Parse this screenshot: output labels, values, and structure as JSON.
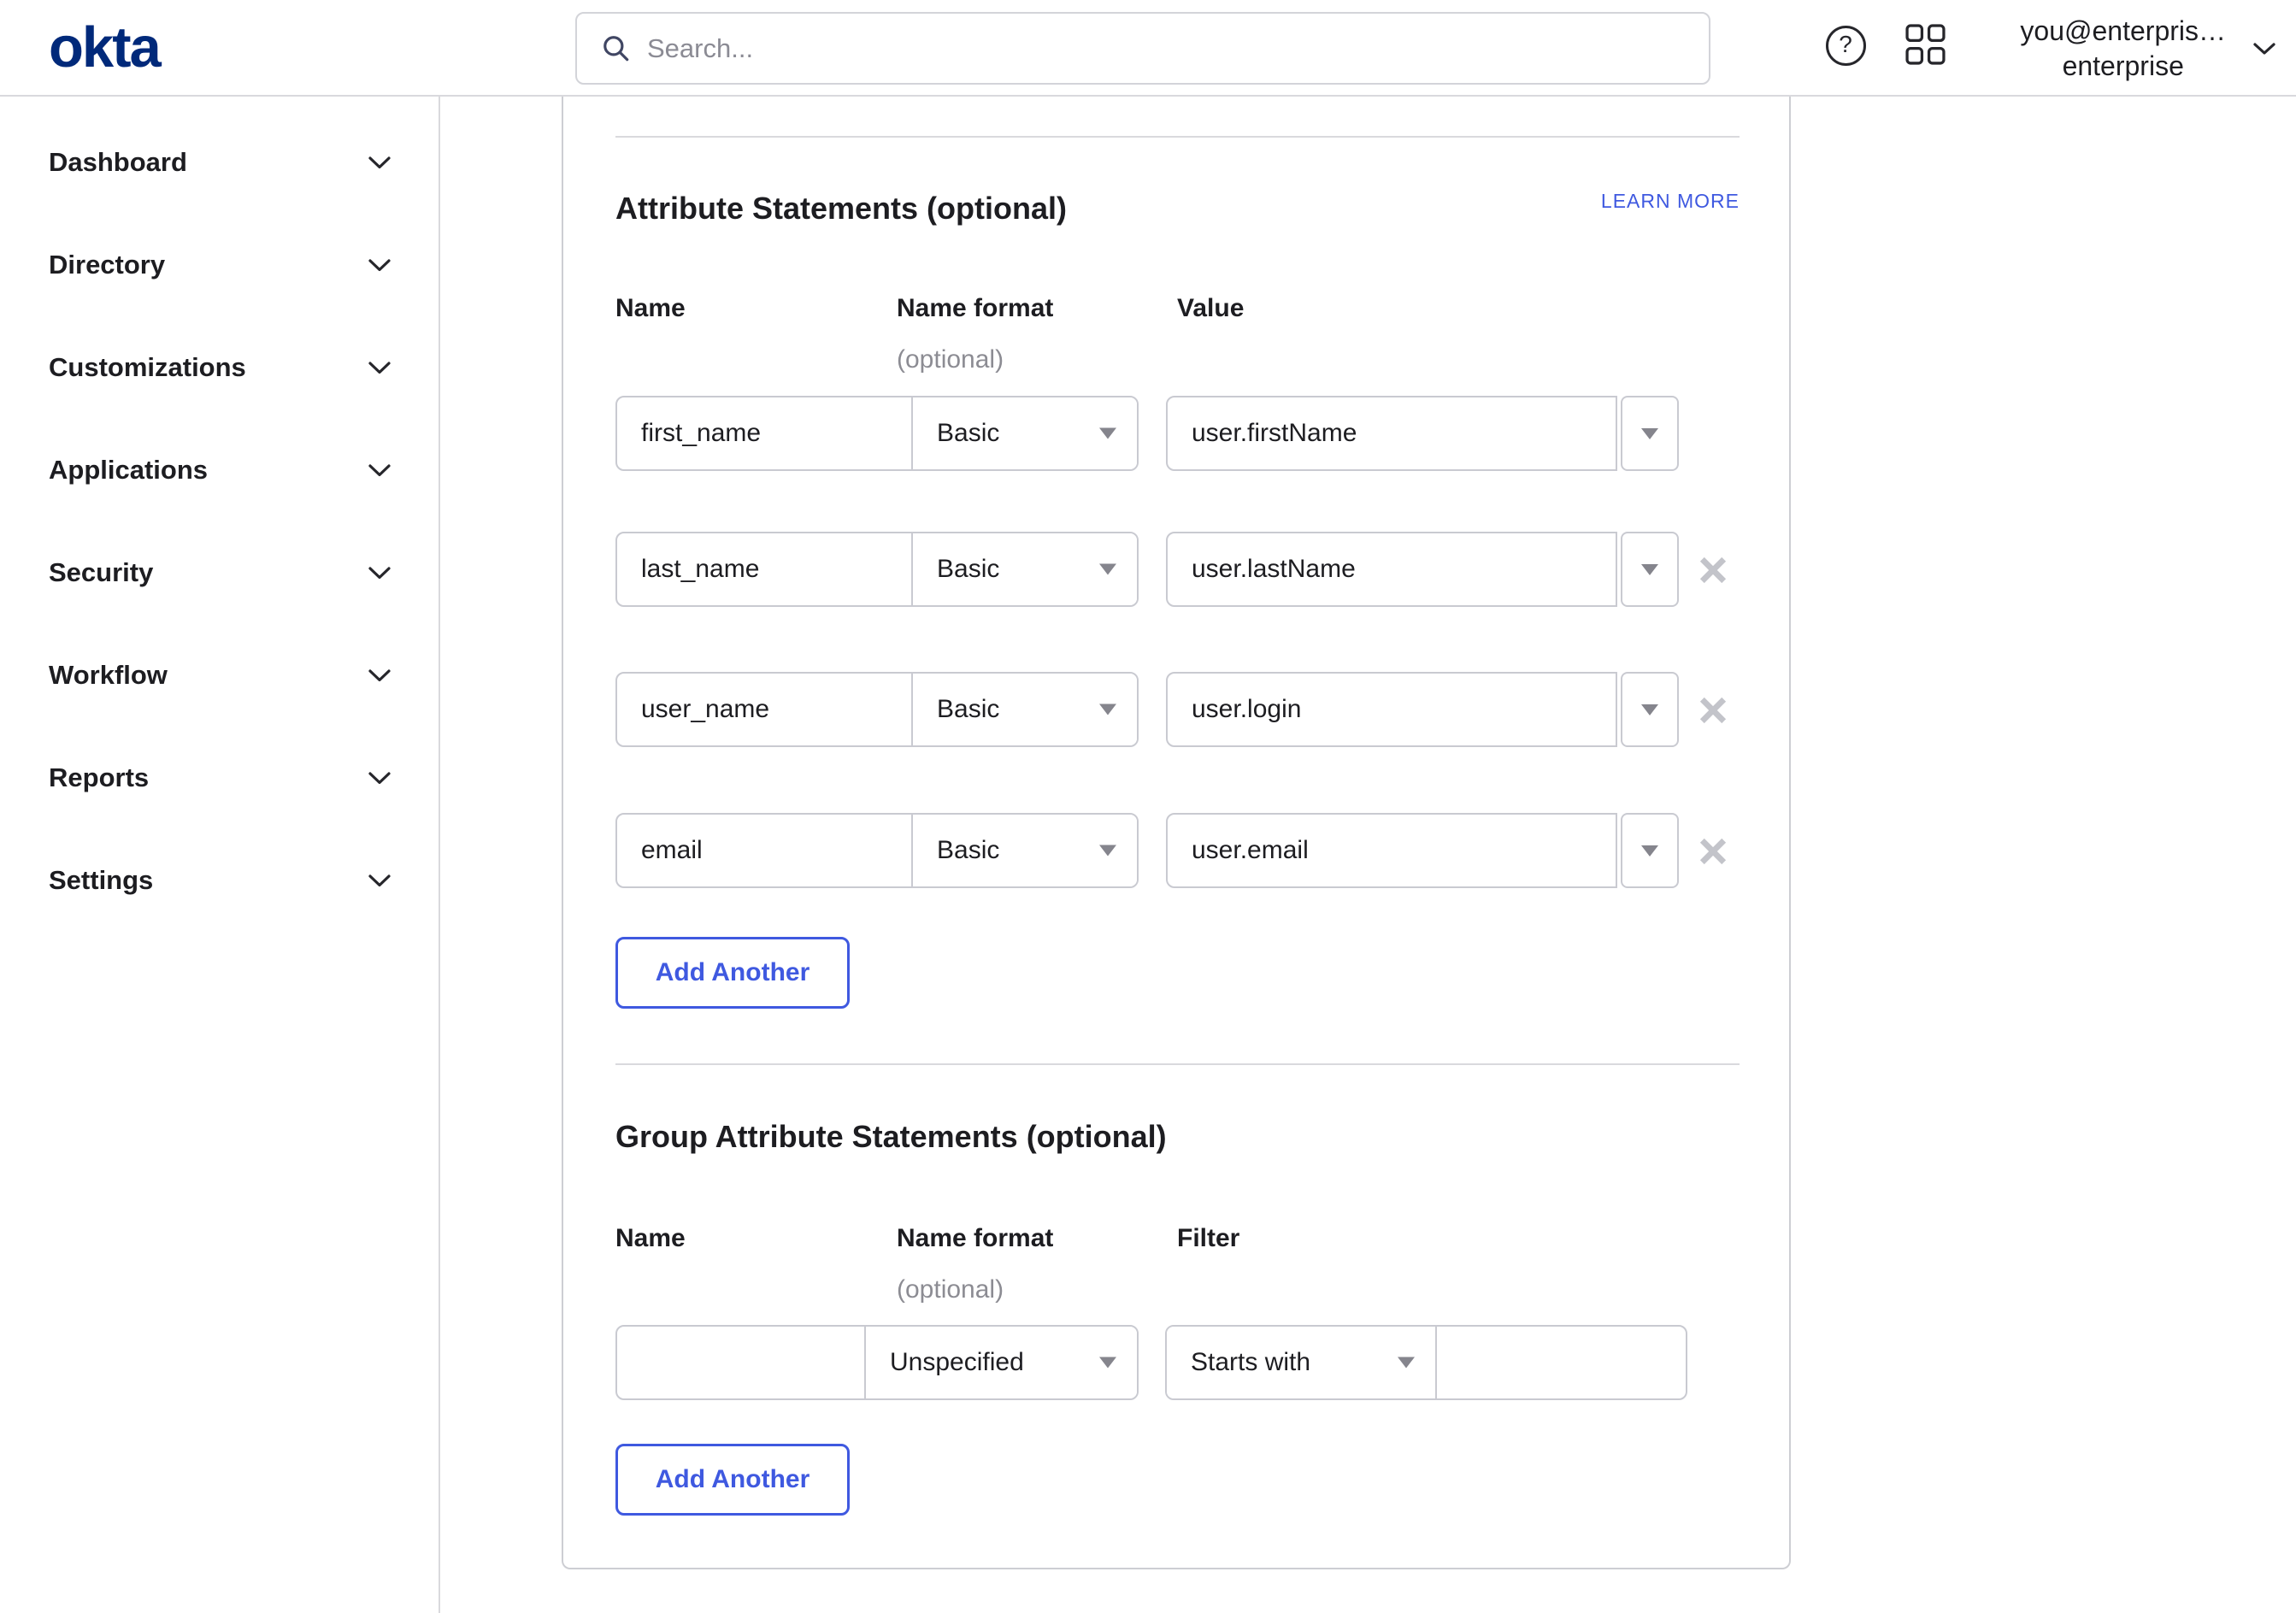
{
  "topbar": {
    "logo": "okta",
    "search_placeholder": "Search...",
    "account": {
      "line1": "you@enterpris…",
      "line2": "enterprise"
    }
  },
  "icons": {
    "help_glyph": "?"
  },
  "sidebar": {
    "items": [
      {
        "label": "Dashboard"
      },
      {
        "label": "Directory"
      },
      {
        "label": "Customizations"
      },
      {
        "label": "Applications"
      },
      {
        "label": "Security"
      },
      {
        "label": "Workflow"
      },
      {
        "label": "Reports"
      },
      {
        "label": "Settings"
      }
    ]
  },
  "main": {
    "attribute_section": {
      "title": "Attribute Statements (optional)",
      "learn_more": "LEARN MORE",
      "columns": {
        "name": "Name",
        "name_format": "Name format",
        "name_format_note": "(optional)",
        "value": "Value"
      },
      "rows": [
        {
          "name": "first_name",
          "format": "Basic",
          "value": "user.firstName",
          "removable": false
        },
        {
          "name": "last_name",
          "format": "Basic",
          "value": "user.lastName",
          "removable": true
        },
        {
          "name": "user_name",
          "format": "Basic",
          "value": "user.login",
          "removable": true
        },
        {
          "name": "email",
          "format": "Basic",
          "value": "user.email",
          "removable": true
        }
      ],
      "add_button": "Add Another"
    },
    "group_section": {
      "title": "Group Attribute Statements (optional)",
      "columns": {
        "name": "Name",
        "name_format": "Name format",
        "name_format_note": "(optional)",
        "filter": "Filter"
      },
      "rows": [
        {
          "name": "",
          "format": "Unspecified",
          "filter_type": "Starts with",
          "filter_value": ""
        }
      ],
      "add_button": "Add Another"
    }
  },
  "colors": {
    "ink": "#1d1d21",
    "muted": "#8c8c93",
    "border": "#c9cad1",
    "border-light": "#d3d4d9",
    "card-border": "#cdced3",
    "divider": "#d9d9dd",
    "accent": "#3f59e0",
    "logo": "#00297a",
    "icon": "#26262b",
    "x-gray": "#c3c4ca",
    "tri": "#85858d",
    "search-icon": "#404663",
    "placeholder": "#8b8b94"
  }
}
